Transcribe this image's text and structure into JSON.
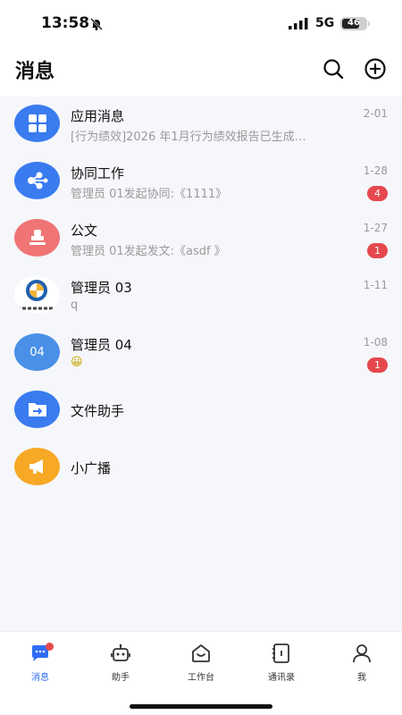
{
  "status_bar": {
    "time": "13:58",
    "network": "5G",
    "battery": "46"
  },
  "header": {
    "title": "消息"
  },
  "messages": [
    {
      "name": "应用消息",
      "preview": "[行为绩效]2026 年1月行为绩效报告已生成…",
      "date": "2-01",
      "badge": "",
      "avatar_color": "#3a7bf0",
      "avatar_icon": "grid-icon"
    },
    {
      "name": "协同工作",
      "preview": "管理员 01发起协同:《1111》",
      "date": "1-28",
      "badge": "4",
      "avatar_color": "#3a7bf0",
      "avatar_icon": "share-icon"
    },
    {
      "name": "公文",
      "preview": "管理员 01发起发文:《asdf 》",
      "date": "1-27",
      "badge": "1",
      "avatar_color": "#f07474",
      "avatar_icon": "stamp-icon"
    },
    {
      "name": "管理员 03",
      "preview": "q",
      "date": "1-11",
      "badge": "",
      "avatar_label": "辽宁金控",
      "avatar_icon": "company-logo"
    },
    {
      "name": "管理员 04",
      "preview": "😀",
      "date": "1-08",
      "badge": "1",
      "avatar_color": "#4a90e8",
      "avatar_label": "04"
    },
    {
      "name": "文件助手",
      "preview": "",
      "date": "",
      "badge": "",
      "avatar_color": "#3a7bf0",
      "avatar_icon": "folder-icon"
    },
    {
      "name": "小广播",
      "preview": "",
      "date": "",
      "badge": "",
      "avatar_color": "#f7a825",
      "avatar_icon": "megaphone-icon"
    }
  ],
  "tabs": [
    {
      "label": "消息",
      "icon": "chat-icon",
      "active": true
    },
    {
      "label": "助手",
      "icon": "robot-icon",
      "active": false
    },
    {
      "label": "工作台",
      "icon": "home-icon",
      "active": false
    },
    {
      "label": "通讯录",
      "icon": "contacts-icon",
      "active": false
    },
    {
      "label": "我",
      "icon": "person-icon",
      "active": false
    }
  ],
  "colors": {
    "accent": "#2f6df6",
    "badge": "#e5484d"
  }
}
